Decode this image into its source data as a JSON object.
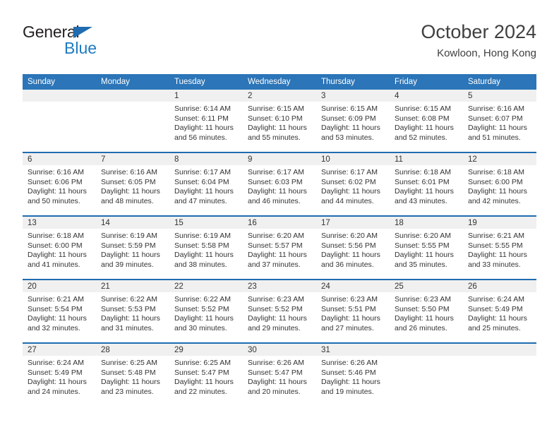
{
  "brand": {
    "name_top": "General",
    "name_bottom": "Blue",
    "accent_color": "#1f7bc1",
    "triangle_color": "#1f6cb0"
  },
  "header": {
    "title": "October 2024",
    "subtitle": "Kowloon, Hong Kong"
  },
  "calendar": {
    "header_bg": "#2b75b8",
    "separator_color": "#1f6cb0",
    "daynum_bg": "#f0f0f0",
    "weekdays": [
      "Sunday",
      "Monday",
      "Tuesday",
      "Wednesday",
      "Thursday",
      "Friday",
      "Saturday"
    ],
    "weeks": [
      [
        {
          "day": ""
        },
        {
          "day": ""
        },
        {
          "day": "1",
          "sunrise": "Sunrise: 6:14 AM",
          "sunset": "Sunset: 6:11 PM",
          "daylight": "Daylight: 11 hours and 56 minutes."
        },
        {
          "day": "2",
          "sunrise": "Sunrise: 6:15 AM",
          "sunset": "Sunset: 6:10 PM",
          "daylight": "Daylight: 11 hours and 55 minutes."
        },
        {
          "day": "3",
          "sunrise": "Sunrise: 6:15 AM",
          "sunset": "Sunset: 6:09 PM",
          "daylight": "Daylight: 11 hours and 53 minutes."
        },
        {
          "day": "4",
          "sunrise": "Sunrise: 6:15 AM",
          "sunset": "Sunset: 6:08 PM",
          "daylight": "Daylight: 11 hours and 52 minutes."
        },
        {
          "day": "5",
          "sunrise": "Sunrise: 6:16 AM",
          "sunset": "Sunset: 6:07 PM",
          "daylight": "Daylight: 11 hours and 51 minutes."
        }
      ],
      [
        {
          "day": "6",
          "sunrise": "Sunrise: 6:16 AM",
          "sunset": "Sunset: 6:06 PM",
          "daylight": "Daylight: 11 hours and 50 minutes."
        },
        {
          "day": "7",
          "sunrise": "Sunrise: 6:16 AM",
          "sunset": "Sunset: 6:05 PM",
          "daylight": "Daylight: 11 hours and 48 minutes."
        },
        {
          "day": "8",
          "sunrise": "Sunrise: 6:17 AM",
          "sunset": "Sunset: 6:04 PM",
          "daylight": "Daylight: 11 hours and 47 minutes."
        },
        {
          "day": "9",
          "sunrise": "Sunrise: 6:17 AM",
          "sunset": "Sunset: 6:03 PM",
          "daylight": "Daylight: 11 hours and 46 minutes."
        },
        {
          "day": "10",
          "sunrise": "Sunrise: 6:17 AM",
          "sunset": "Sunset: 6:02 PM",
          "daylight": "Daylight: 11 hours and 44 minutes."
        },
        {
          "day": "11",
          "sunrise": "Sunrise: 6:18 AM",
          "sunset": "Sunset: 6:01 PM",
          "daylight": "Daylight: 11 hours and 43 minutes."
        },
        {
          "day": "12",
          "sunrise": "Sunrise: 6:18 AM",
          "sunset": "Sunset: 6:00 PM",
          "daylight": "Daylight: 11 hours and 42 minutes."
        }
      ],
      [
        {
          "day": "13",
          "sunrise": "Sunrise: 6:18 AM",
          "sunset": "Sunset: 6:00 PM",
          "daylight": "Daylight: 11 hours and 41 minutes."
        },
        {
          "day": "14",
          "sunrise": "Sunrise: 6:19 AM",
          "sunset": "Sunset: 5:59 PM",
          "daylight": "Daylight: 11 hours and 39 minutes."
        },
        {
          "day": "15",
          "sunrise": "Sunrise: 6:19 AM",
          "sunset": "Sunset: 5:58 PM",
          "daylight": "Daylight: 11 hours and 38 minutes."
        },
        {
          "day": "16",
          "sunrise": "Sunrise: 6:20 AM",
          "sunset": "Sunset: 5:57 PM",
          "daylight": "Daylight: 11 hours and 37 minutes."
        },
        {
          "day": "17",
          "sunrise": "Sunrise: 6:20 AM",
          "sunset": "Sunset: 5:56 PM",
          "daylight": "Daylight: 11 hours and 36 minutes."
        },
        {
          "day": "18",
          "sunrise": "Sunrise: 6:20 AM",
          "sunset": "Sunset: 5:55 PM",
          "daylight": "Daylight: 11 hours and 35 minutes."
        },
        {
          "day": "19",
          "sunrise": "Sunrise: 6:21 AM",
          "sunset": "Sunset: 5:55 PM",
          "daylight": "Daylight: 11 hours and 33 minutes."
        }
      ],
      [
        {
          "day": "20",
          "sunrise": "Sunrise: 6:21 AM",
          "sunset": "Sunset: 5:54 PM",
          "daylight": "Daylight: 11 hours and 32 minutes."
        },
        {
          "day": "21",
          "sunrise": "Sunrise: 6:22 AM",
          "sunset": "Sunset: 5:53 PM",
          "daylight": "Daylight: 11 hours and 31 minutes."
        },
        {
          "day": "22",
          "sunrise": "Sunrise: 6:22 AM",
          "sunset": "Sunset: 5:52 PM",
          "daylight": "Daylight: 11 hours and 30 minutes."
        },
        {
          "day": "23",
          "sunrise": "Sunrise: 6:23 AM",
          "sunset": "Sunset: 5:52 PM",
          "daylight": "Daylight: 11 hours and 29 minutes."
        },
        {
          "day": "24",
          "sunrise": "Sunrise: 6:23 AM",
          "sunset": "Sunset: 5:51 PM",
          "daylight": "Daylight: 11 hours and 27 minutes."
        },
        {
          "day": "25",
          "sunrise": "Sunrise: 6:23 AM",
          "sunset": "Sunset: 5:50 PM",
          "daylight": "Daylight: 11 hours and 26 minutes."
        },
        {
          "day": "26",
          "sunrise": "Sunrise: 6:24 AM",
          "sunset": "Sunset: 5:49 PM",
          "daylight": "Daylight: 11 hours and 25 minutes."
        }
      ],
      [
        {
          "day": "27",
          "sunrise": "Sunrise: 6:24 AM",
          "sunset": "Sunset: 5:49 PM",
          "daylight": "Daylight: 11 hours and 24 minutes."
        },
        {
          "day": "28",
          "sunrise": "Sunrise: 6:25 AM",
          "sunset": "Sunset: 5:48 PM",
          "daylight": "Daylight: 11 hours and 23 minutes."
        },
        {
          "day": "29",
          "sunrise": "Sunrise: 6:25 AM",
          "sunset": "Sunset: 5:47 PM",
          "daylight": "Daylight: 11 hours and 22 minutes."
        },
        {
          "day": "30",
          "sunrise": "Sunrise: 6:26 AM",
          "sunset": "Sunset: 5:47 PM",
          "daylight": "Daylight: 11 hours and 20 minutes."
        },
        {
          "day": "31",
          "sunrise": "Sunrise: 6:26 AM",
          "sunset": "Sunset: 5:46 PM",
          "daylight": "Daylight: 11 hours and 19 minutes."
        },
        {
          "day": ""
        },
        {
          "day": ""
        }
      ]
    ]
  }
}
